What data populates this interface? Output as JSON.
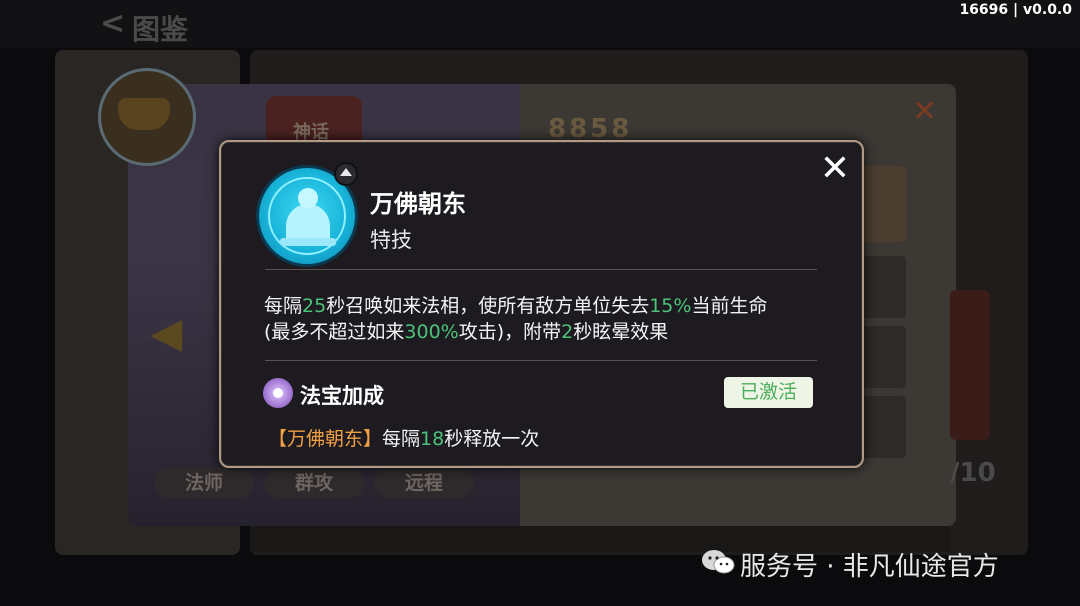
{
  "header": {
    "title": "图鉴",
    "back_glyph": "<",
    "version": "16696 | v0.0.0"
  },
  "background": {
    "rarity_badge": "神话",
    "power_value": "8858",
    "role_tags": [
      "法师",
      "群攻",
      "远程"
    ],
    "page_counter": "/10"
  },
  "modal": {
    "skill_name": "万佛朝东",
    "skill_type": "特技",
    "close_glyph": "✕",
    "description": {
      "seg1": "每隔",
      "interval": "25",
      "seg2": "秒召唤如来法相，使所有敌方单位失去",
      "percent": "15%",
      "seg3": "当前生命",
      "seg4": "(最多不超过如来",
      "cap": "300%",
      "seg5": "攻击)，附带",
      "stun": "2",
      "seg6": "秒眩晕效果"
    },
    "treasure_section": {
      "title": "法宝加成",
      "status": "已激活",
      "bonus_name": "【万佛朝东】",
      "bonus_seg1": "每隔",
      "bonus_interval": "18",
      "bonus_seg2": "秒释放一次"
    }
  },
  "watermark": {
    "text": "服务号 · 非凡仙途官方"
  },
  "colors": {
    "highlight": "#4cc37a",
    "bonus_name": "#f2a144",
    "modal_border": "#b09a86",
    "skill_icon": "#18b4da"
  },
  "icons": {
    "skill": "buddha-statue-icon",
    "rank": "upgrade-arrow-icon",
    "treasure": "treasure-orb-icon",
    "watermark": "wechat-icon"
  }
}
